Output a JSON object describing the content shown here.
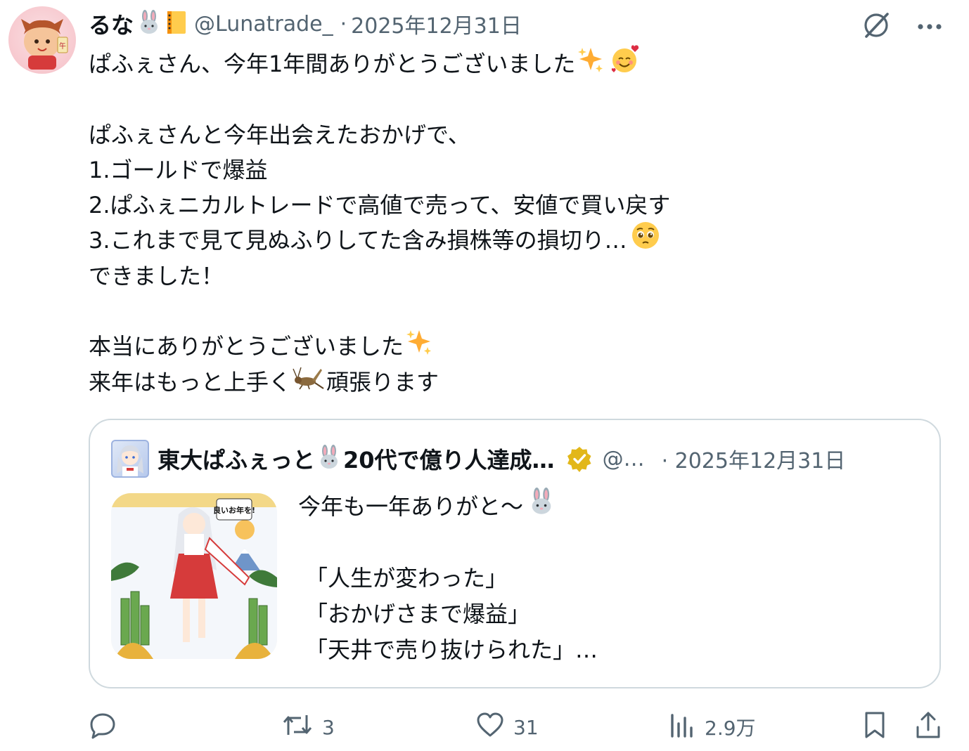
{
  "tweet": {
    "display_name": "るな",
    "name_emojis": [
      "rabbit-face-emoji",
      "ledger-emoji"
    ],
    "handle": "@Lunatrade_",
    "separator": "·",
    "date": "2025年12月31日",
    "lines": [
      {
        "text": "ぱふぇさん、今年1年間ありがとうございました",
        "emojis": [
          "sparkles-emoji",
          "smiling-face-with-hearts-emoji"
        ]
      },
      {
        "text": "",
        "emojis": []
      },
      {
        "text": "ぱふぇさんと今年出会えたおかげで、",
        "emojis": []
      },
      {
        "text": "1.ゴールドで爆益",
        "emojis": []
      },
      {
        "text": "2.ぱふぇニカルトレードで高値で売って、安値で買い戻す",
        "emojis": []
      },
      {
        "text": "3.これまで見て見ぬふりしてた含み損株等の損切り…",
        "emojis": [
          "pleading-face-emoji"
        ]
      },
      {
        "text": "できました！",
        "emojis": []
      },
      {
        "text": "",
        "emojis": []
      },
      {
        "text": "本当にありがとうございました",
        "emojis": [
          "sparkles-emoji"
        ]
      },
      {
        "text_before": "来年はもっと上手く",
        "inline_emoji": "cricket-emoji",
        "text_after": "頑張ります"
      }
    ]
  },
  "quoted": {
    "display_name": "東大ぱふぇっと",
    "name_emoji": "rabbit-face-emoji",
    "name_rest": "20代で億り人達成…",
    "verified_badge": "verified-badge-icon",
    "handle": "@…",
    "date": "· 2025年12月31日",
    "image_caption": "良いお年を!",
    "lines": [
      {
        "text": "今年も一年ありがと〜",
        "emoji": "rabbit-face-emoji"
      },
      {
        "text": "",
        "emoji": ""
      },
      {
        "text": "「人生が変わった」",
        "emoji": ""
      },
      {
        "text": "「おかげさまで爆益」",
        "emoji": ""
      },
      {
        "text": "「天井で売り抜けられた」…",
        "emoji": ""
      }
    ]
  },
  "actions": {
    "reply_count": "",
    "retweet_count": "3",
    "like_count": "31",
    "views_count": "2.9万"
  },
  "icons": {
    "grok": "grok-icon",
    "more": "more-icon",
    "reply": "reply-icon",
    "retweet": "retweet-icon",
    "like": "heart-icon",
    "views": "views-icon",
    "bookmark": "bookmark-icon",
    "share": "share-icon"
  },
  "colors": {
    "text": "#0f1419",
    "secondary": "#536471",
    "border": "#cfd9de",
    "verified_gold": "#e2b719"
  }
}
